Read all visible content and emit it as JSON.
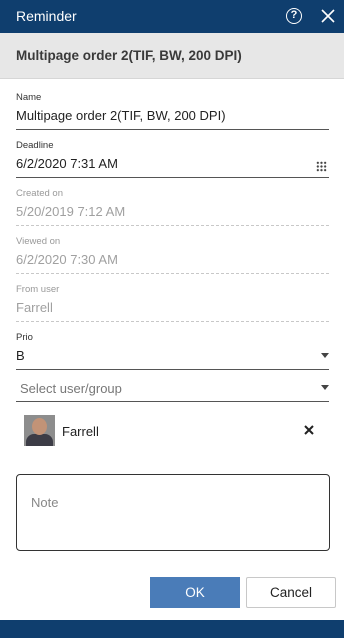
{
  "dialog": {
    "title": "Reminder"
  },
  "subheader": {
    "text": "Multipage order 2(TIF, BW, 200 DPI)"
  },
  "fields": {
    "name": {
      "label": "Name",
      "value": "Multipage order 2(TIF, BW, 200 DPI)"
    },
    "deadline": {
      "label": "Deadline",
      "value": "6/2/2020 7:31 AM"
    },
    "created_on": {
      "label": "Created on",
      "value": "5/20/2019 7:12 AM"
    },
    "viewed_on": {
      "label": "Viewed on",
      "value": "6/2/2020 7:30 AM"
    },
    "from_user": {
      "label": "From user",
      "value": "Farrell"
    },
    "prio": {
      "label": "Prio",
      "value": "B"
    }
  },
  "select_user": {
    "placeholder": "Select user/group"
  },
  "selected_user": {
    "name": "Farrell"
  },
  "note": {
    "placeholder": "Note"
  },
  "buttons": {
    "ok": "OK",
    "cancel": "Cancel"
  },
  "colors": {
    "titlebar": "#0f3e6e",
    "primary_button": "#4a7cb8",
    "subheader_bg": "#e7e7e7"
  }
}
